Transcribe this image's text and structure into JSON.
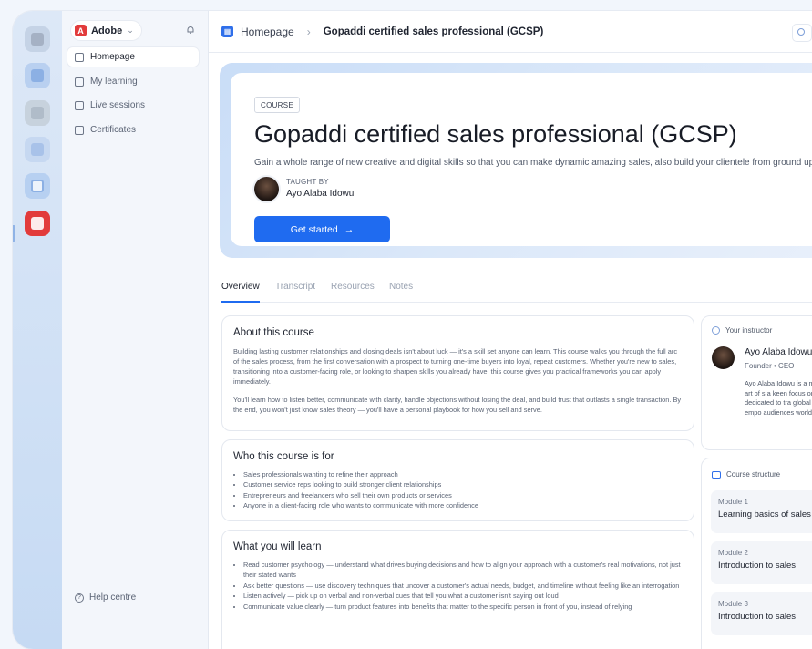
{
  "sidebar": {
    "brand": "Adobe",
    "nav": [
      {
        "label": "Homepage"
      },
      {
        "label": "My learning"
      },
      {
        "label": "Live sessions"
      },
      {
        "label": "Certificates"
      }
    ],
    "help": "Help centre"
  },
  "breadcrumb": {
    "home": "Homepage",
    "current": "Gopaddi certified sales professional (GCSP)"
  },
  "hero": {
    "tag": "COURSE",
    "title": "Gopaddi certified sales professional (GCSP)",
    "description": "Gain a whole range of new creative and digital skills so that you can make dynamic amazing sales, also build your clientele from ground up to finish",
    "taught_by_label": "TAUGHT BY",
    "instructor": "Ayo Alaba Idowu",
    "cta": "Get started"
  },
  "tabs": [
    "Overview",
    "Transcript",
    "Resources",
    "Notes"
  ],
  "about": {
    "title": "About this course",
    "paragraphs": [
      "Building lasting customer relationships and closing deals isn't about luck — it's a skill set anyone can learn. This course walks you through the full arc of the sales process, from the first conversation with a prospect to turning one-time buyers into loyal, repeat customers. Whether you're new to sales, transitioning into a customer-facing role, or looking to sharpen skills you already have, this course gives you practical frameworks you can apply immediately.",
      "You'll learn how to listen better, communicate with clarity, handle objections without losing the deal, and build trust that outlasts a single transaction. By the end, you won't just know sales theory — you'll have a personal playbook for how you sell and serve."
    ]
  },
  "who": {
    "title": "Who this course is for",
    "items": [
      "Sales professionals wanting to refine their approach",
      "Customer service reps looking to build stronger client relationships",
      "Entrepreneurs and freelancers who sell their own products or services",
      "Anyone in a client-facing role who wants to communicate with more confidence"
    ]
  },
  "learn": {
    "title": "What you will learn",
    "items": [
      "Read customer psychology — understand what drives buying decisions and how to align your approach with a customer's real motivations, not just their stated wants",
      "Ask better questions — use discovery techniques that uncover a customer's actual needs, budget, and timeline without feeling like an interrogation",
      "Listen actively — pick up on verbal and non-verbal cues that tell you what a customer isn't saying out loud",
      "Communicate value clearly — turn product features into benefits that matter to the specific person in front of you, instead of relying"
    ]
  },
  "instructor_card": {
    "heading": "Your instructor",
    "name": "Ayo Alaba Idowu",
    "role": "Founder • CEO",
    "bio": "Ayo Alaba Idowu is a mastered the art of s a keen focus on the now dedicated to tra global realities, empo audiences worldwide"
  },
  "structure": {
    "heading": "Course structure",
    "modules": [
      {
        "label": "Module 1",
        "title": "Learning basics of sales"
      },
      {
        "label": "Module 2",
        "title": "Introduction to sales"
      },
      {
        "label": "Module 3",
        "title": "Introduction to sales"
      }
    ]
  },
  "colors": {
    "accent": "#1f6bf0",
    "brand": "#e23b3b"
  }
}
